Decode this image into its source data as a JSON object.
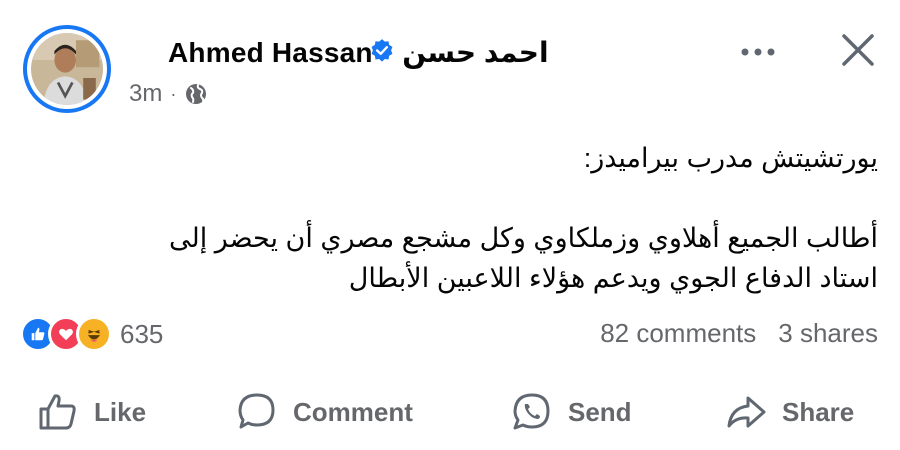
{
  "post": {
    "author_latin": "Ahmed Hassan",
    "author_sep": " - ",
    "author_arabic": "احمد حسن",
    "time": "3m",
    "separator": "·",
    "privacy_icon": "globe-icon",
    "body_line1": "يورتشيتش مدرب بيراميدز:",
    "body_line2": "أطالب الجميع أهلاوي وزملكاوي وكل مشجع مصري أن يحضر إلى",
    "body_line3": "استاد الدفاع الجوي ويدعم هؤلاء اللاعبين الأبطال"
  },
  "reactions": {
    "icons": [
      "like-reaction-icon",
      "love-reaction-icon",
      "haha-reaction-icon"
    ],
    "count": "635"
  },
  "stats": {
    "comments": "82 comments",
    "shares": "3 shares"
  },
  "actions": {
    "like": "Like",
    "comment": "Comment",
    "send": "Send",
    "share": "Share"
  },
  "colors": {
    "brand_blue": "#1877f2",
    "muted_text": "#65676b",
    "like_blue": "#1877f2",
    "love_red": "#f33e58",
    "haha_yellow": "#f7b125"
  }
}
